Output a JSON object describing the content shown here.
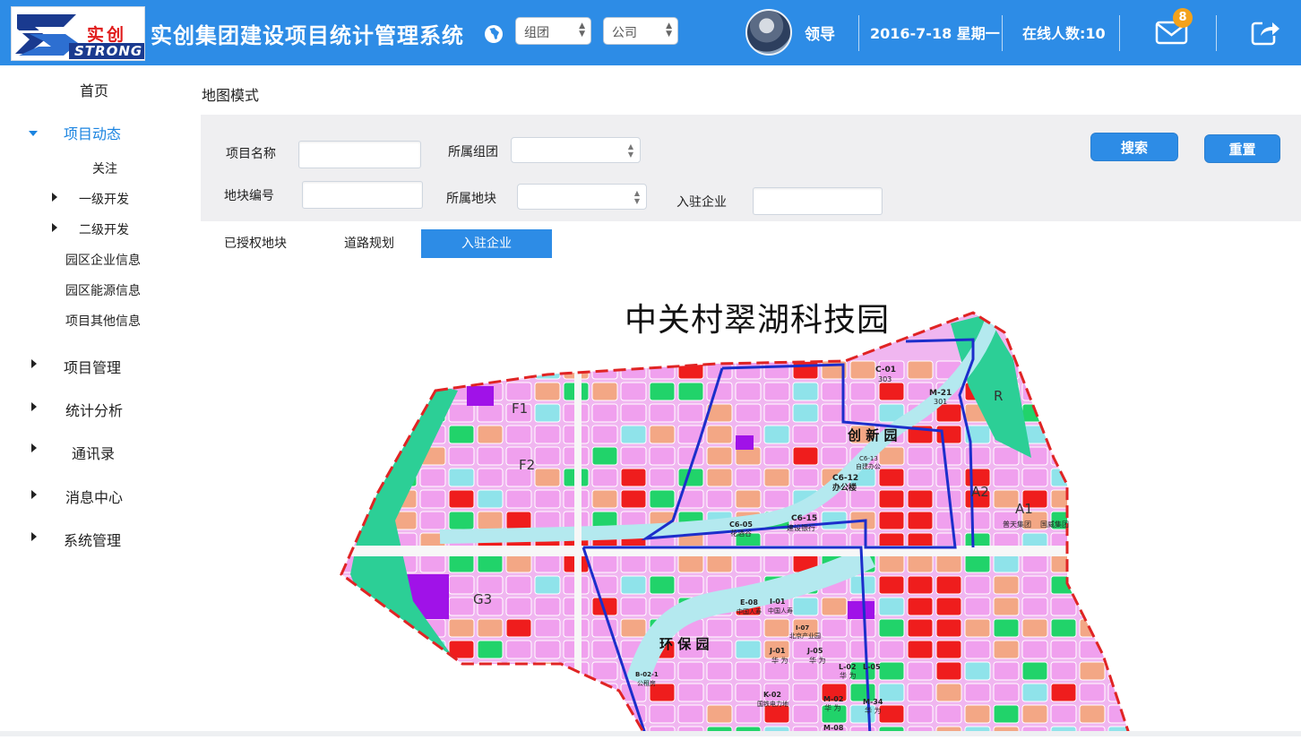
{
  "header": {
    "logo_cn": "实创",
    "logo_en": "STRONG",
    "title": "实创集团建设项目统计管理系统",
    "group_select": "组团",
    "company_select": "公司",
    "user_name": "领导",
    "date": "2016-7-18 星期一",
    "online": "在线人数:10",
    "mail_count": "8",
    "accent_color": "#2d8ce6"
  },
  "sidebar": {
    "home": "首页",
    "project_dynamics": "项目动态",
    "follow": "关注",
    "level1_dev": "一级开发",
    "level2_dev": "二级开发",
    "park_company": "园区企业信息",
    "park_energy": "园区能源信息",
    "project_other": "项目其他信息",
    "project_mgmt": "项目管理",
    "statistics": "统计分析",
    "contacts": "通讯录",
    "message_center": "消息中心",
    "system_mgmt": "系统管理"
  },
  "main": {
    "page_title": "地图模式",
    "filter": {
      "project_name_label": "项目名称",
      "project_name_value": "",
      "group_label": "所属组团",
      "group_value": "",
      "plot_no_label": "地块编号",
      "plot_no_value": "",
      "block_label": "所属地块",
      "block_value": "",
      "enterprise_label": "入驻企业",
      "enterprise_value": "",
      "search_button": "搜索",
      "reset_button": "重置"
    },
    "tabs": [
      {
        "label": "已授权地块",
        "selected": false
      },
      {
        "label": "道路规划",
        "selected": false
      },
      {
        "label": "入驻企业",
        "selected": true
      }
    ],
    "map": {
      "title": "中关村翠湖科技园",
      "zone_innovation": "创 新 园",
      "zone_environment": "环 保 园",
      "labels": {
        "f1": "F1",
        "f2": "F2",
        "g3": "G3",
        "a1": "A1",
        "a2": "A2",
        "r": "R",
        "c01": "C-01",
        "c01b": "303",
        "m21": "M-21",
        "m21b": "301",
        "c6_05": "C6-05",
        "c6_05b": "花酒谷",
        "c6_15": "C6-15",
        "c6_15b": "建设银行",
        "c6_12": "C6-12",
        "c6_12b": "办公楼",
        "c6_13": "C6-13",
        "c6_13b": "自建办公",
        "e08": "E-08",
        "e08b": "中国人寿",
        "i01": "I-01",
        "i01b": "中国人寿",
        "j01": "J-01",
        "j01b": "华 为",
        "j05": "J-05",
        "j05b": "华 为",
        "l02": "L-02",
        "l02b": "华 为",
        "l05": "L-05",
        "k02": "K-02",
        "k02b": "国铁电力地",
        "m02": "M-02",
        "m02b": "华 为",
        "m34": "M-34",
        "m34b": "华 为",
        "m08": "M-08",
        "b02": "B-02-1",
        "b02b": "公租房",
        "i07": "I-07",
        "i07b": "北京产业园",
        "puguan": "普天集团",
        "guowei": "国威集团"
      }
    }
  }
}
